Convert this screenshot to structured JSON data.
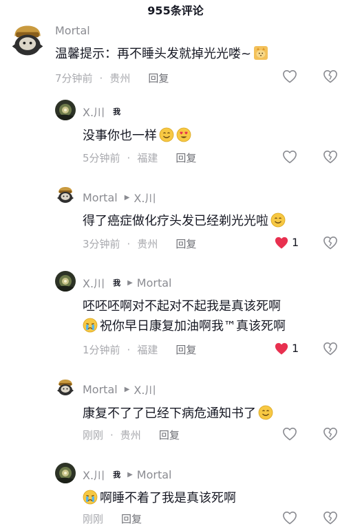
{
  "header": {
    "title": "955条评论"
  },
  "comments": [
    {
      "author": "Mortal",
      "text": "温馨提示：再不睡头发就掉光光喽~",
      "time": "7分钟前",
      "location": "贵州",
      "reply": "回复"
    },
    {
      "author": "X.川",
      "badge": "我",
      "text": "没事你也一样",
      "time": "5分钟前",
      "location": "福建",
      "reply": "回复"
    },
    {
      "author": "Mortal",
      "reply_to": "X.川",
      "text": "得了癌症做化疗头发已经剃光光啦",
      "time": "3分钟前",
      "location": "贵州",
      "reply": "回复",
      "likes": "1"
    },
    {
      "author": "X.川",
      "badge": "我",
      "reply_to": "Mortal",
      "text_line1": "呸呸呸啊对不起对不起我是真该死啊",
      "text_line2": "祝你早日康复加油啊我™真该死啊",
      "time": "1分钟前",
      "location": "福建",
      "reply": "回复",
      "likes": "1"
    },
    {
      "author": "Mortal",
      "reply_to": "X.川",
      "text": "康复不了了已经下病危通知书了",
      "time": "刚刚",
      "location": "贵州",
      "reply": "回复"
    },
    {
      "author": "X.川",
      "badge": "我",
      "reply_to": "Mortal",
      "text": "啊睡不着了我是真该死啊",
      "time": "刚刚",
      "reply": "回复"
    }
  ],
  "colors": {
    "liked_heart": "#e8304f",
    "unliked_heart": "#8a8b91",
    "primary_text": "#161823",
    "secondary_text": "#8a8b91"
  },
  "icons": [
    "heart-outline-icon",
    "heart-filled-icon",
    "broken-heart-icon",
    "reply-arrow-icon",
    "smile-emoji-icon",
    "heart-eyes-emoji-icon",
    "crying-emoji-icon",
    "cat-emoji-icon"
  ]
}
